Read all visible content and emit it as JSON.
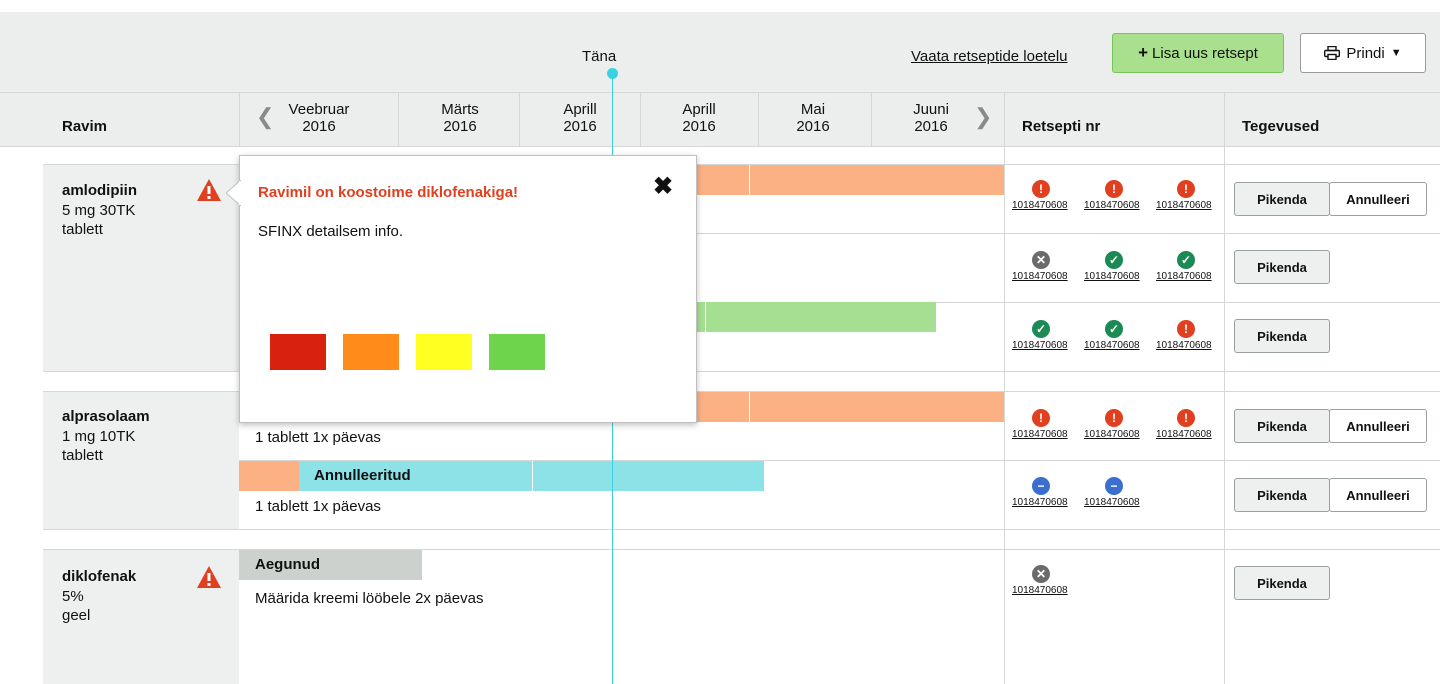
{
  "topbar": {
    "today_label": "Täna",
    "list_link": "Vaata retseptide loetelu",
    "add_button": "Lisa uus retsept",
    "print_button": "Prindi"
  },
  "table_header": {
    "drug_col": "Ravim",
    "rx_col": "Retsepti nr",
    "actions_col": "Tegevused",
    "months": [
      {
        "month": "Veebruar",
        "year": "2016"
      },
      {
        "month": "Märts",
        "year": "2016"
      },
      {
        "month": "Aprill",
        "year": "2016"
      },
      {
        "month": "Aprill",
        "year": "2016"
      },
      {
        "month": "Mai",
        "year": "2016"
      },
      {
        "month": "Juuni",
        "year": "2016"
      }
    ]
  },
  "drugs": [
    {
      "name": "amlodipiin",
      "dose": "5 mg 30TK",
      "form": "tablett"
    },
    {
      "name": "alprasolaam",
      "dose": "1 mg 10TK",
      "form": "tablett"
    },
    {
      "name": "diklofenak",
      "dose": "5%",
      "form": "geel"
    }
  ],
  "rows": {
    "alpr_1_dose": "1 tablett 1x päevas",
    "alpr_2_status": "Annulleeritud",
    "alpr_2_dose": "1 tablett 1x päevas",
    "dikl_status": "Aegunud",
    "dikl_dose": "Määrida kreemi lööbele 2x päevas"
  },
  "rx_number": "1018470608",
  "buttons": {
    "extend": "Pikenda",
    "cancel": "Annulleeri"
  },
  "popup": {
    "title": "Ravimil on koostoime diklofenakiga!",
    "body": "SFINX detailsem info.",
    "colors": [
      "#d9220e",
      "#ff8c1a",
      "#ffff22",
      "#6dd44c"
    ]
  },
  "colors": {
    "accent_green": "#a8e08e",
    "today_line": "#3ad2e0",
    "warning_red": "#e0401f"
  }
}
